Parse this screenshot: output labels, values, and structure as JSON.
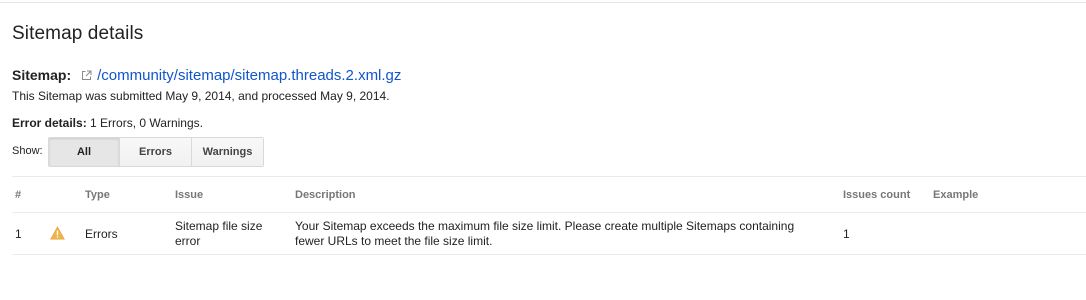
{
  "page": {
    "title": "Sitemap details"
  },
  "sitemap": {
    "label": "Sitemap:",
    "link_icon": "external-link-icon",
    "path": "/community/sitemap/sitemap.threads.2.xml.gz",
    "submitted_text": "This Sitemap was submitted May 9, 2014, and processed May 9, 2014."
  },
  "error_details": {
    "label": "Error details:",
    "summary": "1 Errors, 0 Warnings."
  },
  "filter": {
    "show_label": "Show:",
    "options": [
      "All",
      "Errors",
      "Warnings"
    ],
    "selected": "All"
  },
  "table": {
    "headers": [
      "#",
      "Type",
      "Issue",
      "Description",
      "Issues count",
      "Example"
    ],
    "rows": [
      {
        "index": "1",
        "icon": "warning-icon",
        "type": "Errors",
        "issue_line1": "Sitemap file size",
        "issue_line2": "error",
        "description_line1": "Your Sitemap exceeds the maximum file size limit. Please create multiple Sitemaps containing",
        "description_line2": "fewer URLs to meet the file size limit.",
        "issues_count": "1",
        "example": ""
      }
    ]
  },
  "colors": {
    "link": "#1155cc",
    "warning": "#f0b44c",
    "header_text": "#777777"
  }
}
